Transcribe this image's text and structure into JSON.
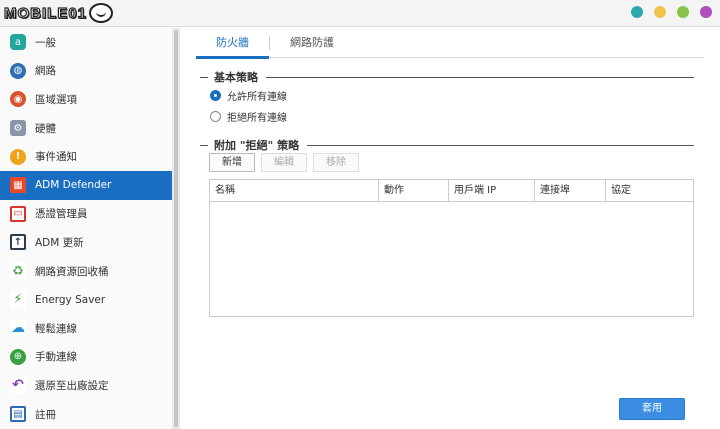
{
  "window": {
    "logo_text": "MOBILE01",
    "buttons": [
      {
        "name": "minimize",
        "color": "#2fa9a8"
      },
      {
        "name": "restore",
        "color": "#f3c24a"
      },
      {
        "name": "maximize",
        "color": "#8bc34a"
      },
      {
        "name": "close",
        "color": "#b34fbd"
      }
    ]
  },
  "sidebar": {
    "items": [
      {
        "label": "一般",
        "icon": "general-icon",
        "color": "#1fa89a",
        "glyph": "a"
      },
      {
        "label": "網路",
        "icon": "globe-icon",
        "color": "#2c6fb3",
        "glyph": "◍"
      },
      {
        "label": "區域選項",
        "icon": "region-icon",
        "color": "#d9542c",
        "glyph": "◉"
      },
      {
        "label": "硬體",
        "icon": "hardware-icon",
        "color": "#8a96a8",
        "glyph": "⚙"
      },
      {
        "label": "事件通知",
        "icon": "notification-icon",
        "color": "#f0a318",
        "glyph": "!"
      },
      {
        "label": "ADM Defender",
        "icon": "firewall-icon",
        "color": "#e44a2a",
        "glyph": "▦"
      },
      {
        "label": "憑證管理員",
        "icon": "certificate-icon",
        "color": "#d9342c",
        "glyph": "▭"
      },
      {
        "label": "ADM 更新",
        "icon": "update-icon",
        "color": "#2d3b4a",
        "glyph": "↑"
      },
      {
        "label": "網路資源回收桶",
        "icon": "recycle-bin-icon",
        "color": "#5aa55a",
        "glyph": "♻"
      },
      {
        "label": "Energy Saver",
        "icon": "energy-saver-icon",
        "color": "#3fa33a",
        "glyph": "⚡"
      },
      {
        "label": "輕鬆連線",
        "icon": "ezconnect-icon",
        "color": "#2c8fd6",
        "glyph": "☁"
      },
      {
        "label": "手動連線",
        "icon": "manual-connect-icon",
        "color": "#3aa043",
        "glyph": "⊕"
      },
      {
        "label": "還原至出廠設定",
        "icon": "restore-icon",
        "color": "#8a3fb3",
        "glyph": "↶"
      },
      {
        "label": "註冊",
        "icon": "register-icon",
        "color": "#2d6ab3",
        "glyph": "▤"
      }
    ],
    "active_index": 5
  },
  "tabs": [
    {
      "label": "防火牆",
      "active": true
    },
    {
      "label": "網路防護",
      "active": false
    }
  ],
  "basic_policy": {
    "title": "基本策略",
    "options": [
      {
        "label": "允許所有連線",
        "selected": true
      },
      {
        "label": "拒絕所有連線",
        "selected": false
      }
    ]
  },
  "extra_policy": {
    "title": "附加 \"拒絕\" 策略",
    "buttons": {
      "add": "新增",
      "edit": "編輯",
      "remove": "移除"
    },
    "columns": [
      "名稱",
      "動作",
      "用戶端 IP",
      "連接埠",
      "協定"
    ]
  },
  "apply_label": "套用"
}
